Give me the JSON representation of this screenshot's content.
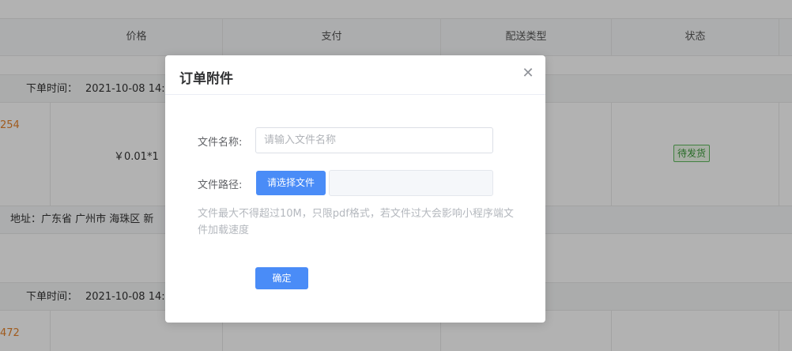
{
  "table": {
    "headers": [
      "价格",
      "支付",
      "配送类型",
      "状态"
    ]
  },
  "orders": [
    {
      "time_label": "下单时间：",
      "time_value": "2021-10-08 14:",
      "id_fragment": "254",
      "price": "￥0.01*1",
      "status": "待发货",
      "address": "地址：广东省 广州市 海珠区 新"
    },
    {
      "time_label": "下单时间：",
      "time_value": "2021-10-08 14:",
      "id_fragment": "472"
    }
  ],
  "modal": {
    "title": "订单附件",
    "close_icon": "close-icon",
    "file_name_label": "文件名称:",
    "file_name_placeholder": "请输入文件名称",
    "file_path_label": "文件路径:",
    "choose_file_label": "请选择文件",
    "file_path_value": "",
    "hint": "文件最大不得超过10M，只限pdf格式，若文件过大会影响小程序端文件加载速度",
    "confirm_label": "确定"
  },
  "colors": {
    "primary": "#4a8cf7",
    "status_green": "#3a9a3a",
    "order_id_orange": "#e5832c",
    "overlay": "rgba(0,0,0,0.3)"
  }
}
